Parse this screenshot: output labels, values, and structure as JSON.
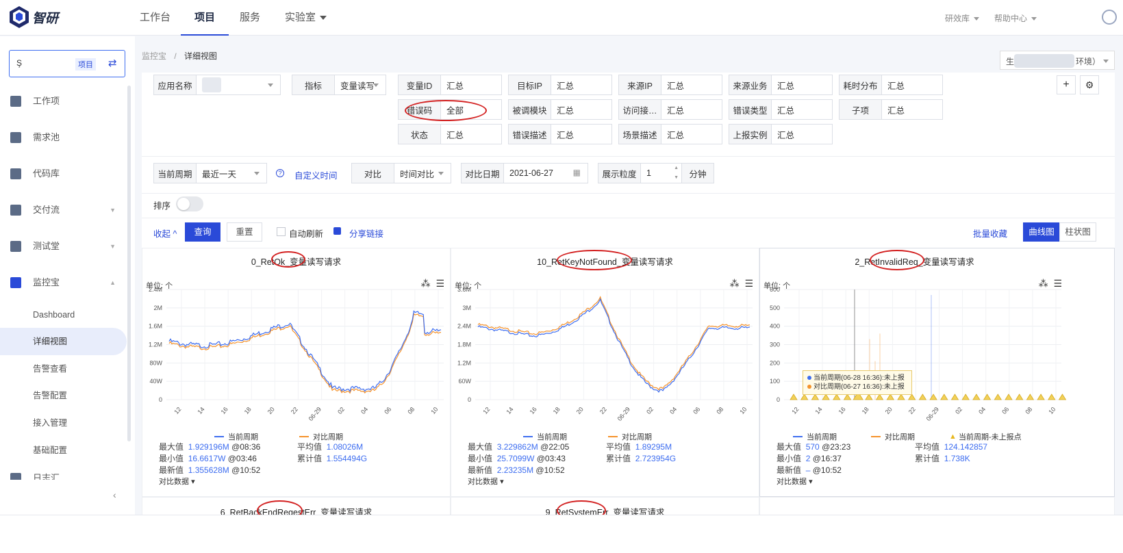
{
  "app": {
    "logo_text": "智研"
  },
  "nav": {
    "items": [
      {
        "label": "工作台"
      },
      {
        "label": "项目",
        "active": true
      },
      {
        "label": "服务"
      },
      {
        "label": "实验室"
      }
    ],
    "right": [
      {
        "label": "研效库"
      },
      {
        "label": "帮助中心"
      }
    ]
  },
  "sidebar": {
    "project_key": "Ş",
    "project_tag": "项目",
    "switch_icon": "swap-icon",
    "menu": [
      {
        "label": "工作项",
        "icon": "dashboard-icon"
      },
      {
        "label": "需求池",
        "icon": "doc-icon"
      },
      {
        "label": "代码库",
        "icon": "terminal-icon"
      },
      {
        "label": "交付流",
        "icon": "pipeline-icon"
      },
      {
        "label": "测试堂",
        "icon": "bug-icon"
      },
      {
        "label": "监控宝",
        "icon": "monitor-icon"
      }
    ],
    "submenu": [
      {
        "label": "Dashboard"
      },
      {
        "label": "详细视图",
        "active": true
      },
      {
        "label": "告警查看"
      },
      {
        "label": "告警配置"
      },
      {
        "label": "接入管理"
      },
      {
        "label": "基础配置"
      }
    ],
    "cut_item": "日志汇"
  },
  "breadcrumb": {
    "root": "监控宝",
    "current": "详细视图"
  },
  "env_select": {
    "prefix": "生",
    "suffix": "环境）"
  },
  "filters": {
    "app_name": {
      "label": "应用名称",
      "value": ""
    },
    "metric": {
      "label": "指标",
      "value": "变量读写"
    },
    "fields": [
      {
        "label": "变量ID",
        "value": "汇总"
      },
      {
        "label": "目标IP",
        "value": "汇总"
      },
      {
        "label": "来源IP",
        "value": "汇总"
      },
      {
        "label": "来源业务",
        "value": "汇总"
      },
      {
        "label": "耗时分布",
        "value": "汇总"
      },
      {
        "label": "错误码",
        "value": "全部"
      },
      {
        "label": "被调模块",
        "value": "汇总"
      },
      {
        "label": "访问接…",
        "value": "汇总"
      },
      {
        "label": "错误类型",
        "value": "汇总"
      },
      {
        "label": "子项",
        "value": "汇总"
      },
      {
        "label": "状态",
        "value": "汇总"
      },
      {
        "label": "错误描述",
        "value": "汇总"
      },
      {
        "label": "场景描述",
        "value": "汇总"
      },
      {
        "label": "上报实例",
        "value": "汇总"
      }
    ]
  },
  "time": {
    "period_label": "当前周期",
    "period_value": "最近一天",
    "custom_time": "自定义时间",
    "compare_label": "对比",
    "compare_value": "时间对比",
    "compare_date_label": "对比日期",
    "compare_date": "2021-06-27",
    "granularity_label": "展示粒度",
    "granularity_value": "1",
    "granularity_unit": "分钟"
  },
  "sort_label": "排序",
  "actions": {
    "collapse": "收起",
    "query": "查询",
    "reset": "重置",
    "auto_refresh": "自动刷新",
    "share": "分享链接",
    "batch_fav": "批量收藏",
    "view_line": "曲线图",
    "view_bar": "柱状图"
  },
  "charts": [
    {
      "title": "0_RetOk_变量读写请求",
      "unit": "单位: 个",
      "yticks": [
        "2.4M",
        "2M",
        "1.6M",
        "1.2M",
        "80W",
        "40W",
        "0"
      ],
      "xticks": [
        "12",
        "14",
        "16",
        "18",
        "20",
        "22",
        "06-29",
        "02",
        "04",
        "06",
        "08",
        "10"
      ],
      "legend": [
        "当前周期",
        "对比周期"
      ],
      "stats": [
        {
          "label": "最大值",
          "value": "1.929196M",
          "at": "@08:36"
        },
        {
          "label": "平均值",
          "value": "1.08026M"
        },
        {
          "label": "最小值",
          "value": "16.6617W",
          "at": "@03:46"
        },
        {
          "label": "累计值",
          "value": "1.554494G"
        },
        {
          "label": "最新值",
          "value": "1.355628M",
          "at": "@10:52"
        }
      ],
      "compare": "对比数据"
    },
    {
      "title": "10_RetKeyNotFound_变量读写请求",
      "unit": "单位: 个",
      "yticks": [
        "3.6M",
        "3M",
        "2.4M",
        "1.8M",
        "1.2M",
        "60W",
        "0"
      ],
      "xticks": [
        "12",
        "14",
        "16",
        "18",
        "20",
        "22",
        "06-29",
        "02",
        "04",
        "06",
        "08",
        "10"
      ],
      "legend": [
        "当前周期",
        "对比周期"
      ],
      "stats": [
        {
          "label": "最大值",
          "value": "3.229862M",
          "at": "@22:05"
        },
        {
          "label": "平均值",
          "value": "1.89295M"
        },
        {
          "label": "最小值",
          "value": "25.7099W",
          "at": "@03:43"
        },
        {
          "label": "累计值",
          "value": "2.723954G"
        },
        {
          "label": "最新值",
          "value": "2.23235M",
          "at": "@10:52"
        }
      ],
      "compare": "对比数据"
    },
    {
      "title": "2_RetInvalidReq_变量读写请求",
      "unit": "单位: 个",
      "yticks": [
        "600",
        "500",
        "400",
        "300",
        "200",
        "100",
        "0"
      ],
      "xticks": [
        "12",
        "14",
        "16",
        "18",
        "20",
        "22",
        "06-29",
        "02",
        "04",
        "06",
        "08",
        "10"
      ],
      "legend": [
        "当前周期",
        "对比周期",
        "当前周期-未上报点"
      ],
      "tooltip": [
        "当前周期(06-28 16:36):未上报",
        "对比周期(06-27 16:36):未上报"
      ],
      "stats": [
        {
          "label": "最大值",
          "value": "570",
          "at": "@23:23"
        },
        {
          "label": "平均值",
          "value": "124.142857"
        },
        {
          "label": "最小值",
          "value": "2",
          "at": "@16:37"
        },
        {
          "label": "累计值",
          "value": "1.738K"
        },
        {
          "label": "最新值",
          "value": "–",
          "at": "@10:52"
        }
      ],
      "compare": "对比数据"
    }
  ],
  "next_charts": [
    {
      "title": "6_RetBackEndReqestErr_变量读写请求"
    },
    {
      "title": "9_RetSystemErr_变量读写请求"
    }
  ],
  "colors": {
    "current": "#3d6df0",
    "compare": "#f5922a",
    "primary": "#2a4ad8",
    "annotation": "#d32020"
  }
}
